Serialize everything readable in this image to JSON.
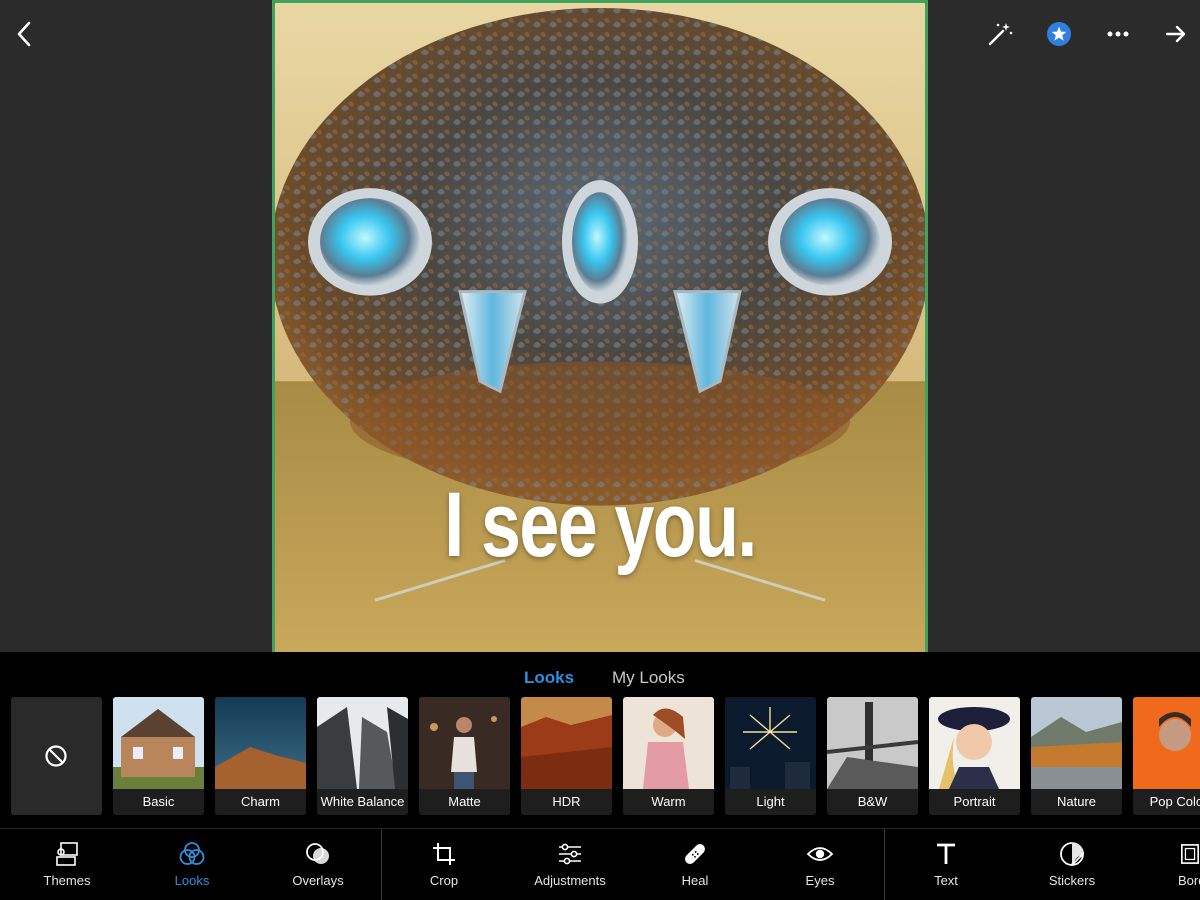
{
  "caption": "I see you.",
  "colors": {
    "accent": "#2f8fde",
    "frame": "#3fa35b",
    "background": "#2b2b2b",
    "panel": "#000000"
  },
  "topbar": {
    "back_icon": "chevron-left-icon",
    "magic_icon": "magic-wand-icon",
    "premium_icon": "star-badge-icon",
    "more_icon": "ellipsis-icon",
    "next_icon": "arrow-right-icon"
  },
  "looks_tabs": [
    {
      "label": "Looks",
      "active": true
    },
    {
      "label": "My Looks",
      "active": false
    }
  ],
  "looks": [
    {
      "label": ""
    },
    {
      "label": "Basic"
    },
    {
      "label": "Charm"
    },
    {
      "label": "White Balance"
    },
    {
      "label": "Matte"
    },
    {
      "label": "HDR"
    },
    {
      "label": "Warm"
    },
    {
      "label": "Light"
    },
    {
      "label": "B&W"
    },
    {
      "label": "Portrait"
    },
    {
      "label": "Nature"
    },
    {
      "label": "Pop Color"
    }
  ],
  "tools": [
    {
      "label": "Themes",
      "icon": "themes-icon",
      "active": false
    },
    {
      "label": "Looks",
      "icon": "looks-icon",
      "active": true
    },
    {
      "label": "Overlays",
      "icon": "overlays-icon",
      "active": false
    },
    {
      "label": "Crop",
      "icon": "crop-icon",
      "active": false
    },
    {
      "label": "Adjustments",
      "icon": "adjustments-icon",
      "active": false
    },
    {
      "label": "Heal",
      "icon": "bandage-icon",
      "active": false
    },
    {
      "label": "Eyes",
      "icon": "eye-icon",
      "active": false
    },
    {
      "label": "Text",
      "icon": "text-icon",
      "active": false
    },
    {
      "label": "Stickers",
      "icon": "sticker-icon",
      "active": false
    },
    {
      "label": "Borders",
      "icon": "border-icon",
      "active": false
    }
  ]
}
